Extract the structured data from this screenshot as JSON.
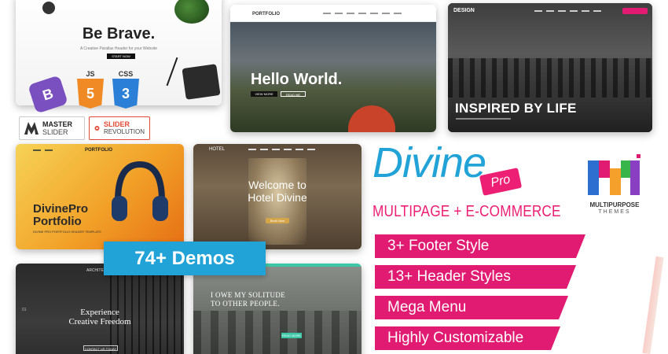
{
  "brave": {
    "title": "Be Brave.",
    "subtitle": "A Creative Parallax Header for your Website",
    "button": "START NOW"
  },
  "tech": {
    "bootstrap": "B",
    "js": {
      "label": "JS",
      "glyph": "5"
    },
    "css": {
      "label": "CSS",
      "glyph": "3"
    }
  },
  "logos": {
    "master": {
      "line1": "MASTER",
      "line2": "SLIDER"
    },
    "revolution": {
      "line1": "SLIDER",
      "line2": "REVOLUTION"
    }
  },
  "hello": {
    "logo": "PORTFOLIO",
    "heading": "Hello World.",
    "btn1": "VIEW MORE",
    "btn2": "READ ME"
  },
  "design": {
    "logo": "DESIGN",
    "heading": "INSPIRED BY LIFE"
  },
  "portfolio": {
    "logo": "PORTFOLIO",
    "heading_line1": "DivinePro",
    "heading_line2": "Portfolio",
    "sub": "DIVINE PRO PORTFOLIO HEADER TEMPLATE"
  },
  "hotel": {
    "logo": "HOTEL",
    "heading_line1": "Welcome to",
    "heading_line2": "Hotel Divine",
    "button": "Book Now"
  },
  "arch": {
    "logo": "ARCHITECT",
    "heading_line1": "Experience",
    "heading_line2": "Creative Freedom",
    "button": "CONTACT US TODAY",
    "index": "01"
  },
  "solitude": {
    "heading_line1": "I OWE MY SOLITUDE",
    "heading_line2": "TO OTHER PEOPLE.",
    "button": "READ MORE"
  },
  "demos": "74+ Demos",
  "brand": {
    "name": "Divine",
    "badge": "Pro",
    "tagline": "MULTIPAGE  +  E-COMMERCE"
  },
  "features": [
    "3+ Footer Style",
    "13+ Header Styles",
    "Mega Menu",
    "Highly Customizable"
  ],
  "mp": {
    "label": "MULTIPURPOSE",
    "sub": "THEMES"
  },
  "colors": {
    "accent_blue": "#21a3d8",
    "accent_pink": "#e11a72"
  }
}
